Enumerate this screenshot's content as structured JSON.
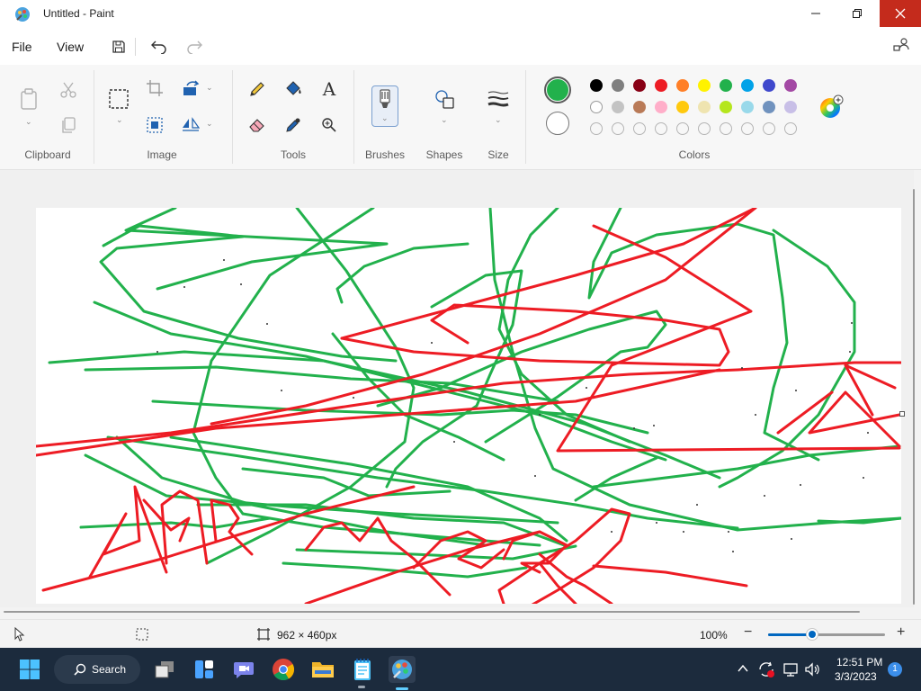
{
  "window": {
    "title": "Untitled - Paint"
  },
  "menu": {
    "file": "File",
    "view": "View"
  },
  "ribbon": {
    "groups": {
      "clipboard": "Clipboard",
      "image": "Image",
      "tools": "Tools",
      "brushes": "Brushes",
      "shapes": "Shapes",
      "size": "Size",
      "colors": "Colors"
    },
    "text_tool_glyph": "A"
  },
  "colors": {
    "color1": "#22b14c",
    "color2": "#ffffff",
    "palette_row1": [
      "#000000",
      "#7f7f7f",
      "#880015",
      "#ed1c24",
      "#ff7f27",
      "#fff200",
      "#22b14c",
      "#00a2e8",
      "#3f48cc",
      "#a349a4"
    ],
    "palette_row2": [
      "#ffffff",
      "#c3c3c3",
      "#b97a57",
      "#ffaec9",
      "#ffc90e",
      "#efe4b0",
      "#b5e61d",
      "#99d9ea",
      "#7092be",
      "#c8bfe7"
    ],
    "palette_row3_empty": 10
  },
  "status": {
    "canvas_size": "962 × 460px",
    "zoom": "100%",
    "zoom_percent": 100,
    "zoom_slider_fraction": 0.38,
    "zoom_minus": "−",
    "zoom_plus": "+"
  },
  "taskbar": {
    "search": "Search",
    "time": "12:51 PM",
    "date": "3/3/2023",
    "notifications": "1"
  }
}
